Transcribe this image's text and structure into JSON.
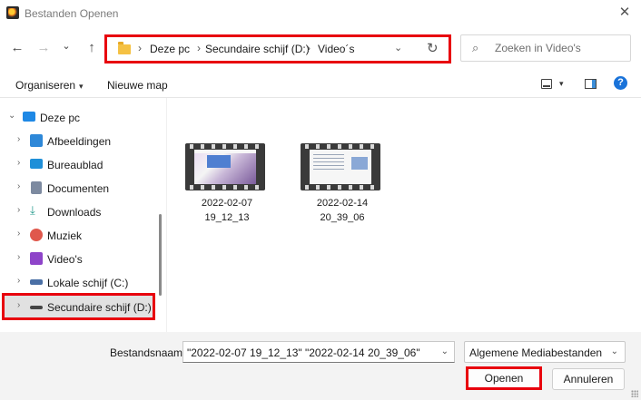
{
  "window": {
    "title": "Bestanden Openen",
    "close_glyph": "✕"
  },
  "nav": {
    "back_glyph": "←",
    "forward_glyph": "→",
    "recent_glyph": "⌄",
    "up_glyph": "↑",
    "breadcrumb": [
      "Deze pc",
      "Secundaire schijf (D:)",
      "Video´s"
    ],
    "sep_glyph": "›",
    "dropdown_glyph": "⌄",
    "refresh_glyph": "↻",
    "search_placeholder": "Zoeken in Video's",
    "search_glyph": "⌕"
  },
  "toolbar": {
    "organize_label": "Organiseren",
    "new_folder_label": "Nieuwe map",
    "caret_glyph": "▾",
    "help_glyph": "?"
  },
  "sidebar": {
    "items": [
      {
        "label": "Deze pc",
        "expanded": true,
        "icon": "monitor-icon",
        "color": "#1e88e5"
      },
      {
        "label": "Afbeeldingen",
        "icon": "pictures-icon",
        "color": "#2e88d8"
      },
      {
        "label": "Bureaublad",
        "icon": "desktop-icon",
        "color": "#1f8fd8"
      },
      {
        "label": "Documenten",
        "icon": "documents-icon",
        "color": "#7d8aa0"
      },
      {
        "label": "Downloads",
        "icon": "download-icon",
        "color": "#2a9d8f"
      },
      {
        "label": "Muziek",
        "icon": "music-icon",
        "color": "#e0584c"
      },
      {
        "label": "Video's",
        "icon": "video-icon",
        "color": "#8e44c9"
      },
      {
        "label": "Lokale schijf (C:)",
        "icon": "drive-c-icon",
        "color": "#4a6fa5"
      },
      {
        "label": "Secundaire schijf (D:)",
        "icon": "drive-icon",
        "color": "#444444",
        "selected": true
      }
    ],
    "chevron_right": "›",
    "chevron_down": "⌄"
  },
  "files": [
    {
      "name_line1": "2022-02-07",
      "name_line2": "19_12_13"
    },
    {
      "name_line1": "2022-02-14",
      "name_line2": "20_39_06"
    }
  ],
  "footer": {
    "filename_label": "Bestandsnaam:",
    "filename_value": "\"2022-02-07 19_12_13\" \"2022-02-14 20_39_06\"",
    "filetype_value": "Algemene Mediabestanden",
    "open_label": "Openen",
    "cancel_label": "Annuleren",
    "dropdown_glyph": "⌄"
  },
  "colors": {
    "highlight": "#e8000d",
    "accent": "#1a73d9",
    "folder": "#f5c143"
  }
}
